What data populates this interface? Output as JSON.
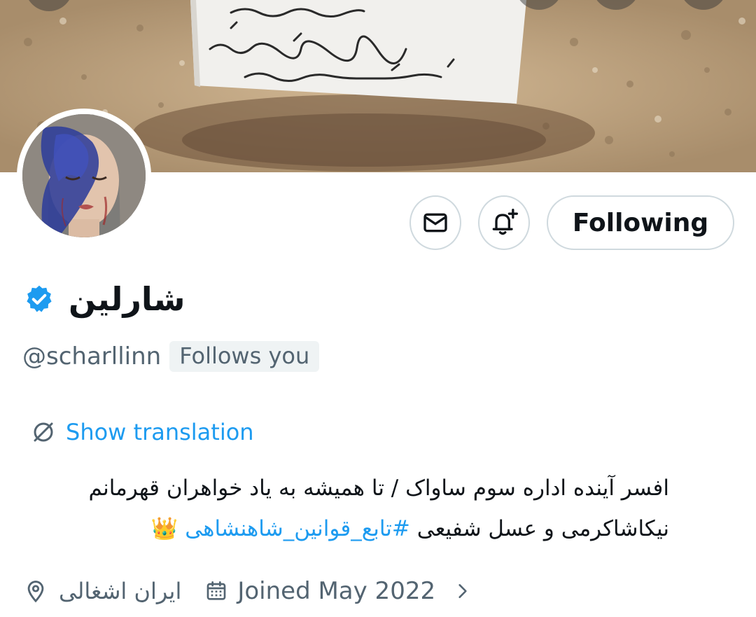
{
  "profile": {
    "display_name": "شارلین",
    "handle": "@scharllinn",
    "follows_you_badge": "Follows you",
    "verified": true,
    "verified_color": "#1d9bf0"
  },
  "actions": {
    "message_icon": "envelope-icon",
    "notify_icon": "bell-plus-icon",
    "follow_label": "Following"
  },
  "translation": {
    "label": "Show translation",
    "icon": "translate-icon"
  },
  "bio": {
    "line1": "افسر آینده اداره سوم ساواک / تا همیشه به یاد خواهران قهرمانم",
    "line2_text": "نیکاشاکرمی و عسل شفیعی ",
    "hashtag": "#تابع_قوانین_شاهنشاهی",
    "emoji": "👑"
  },
  "meta": {
    "location": "ایران اشغالی",
    "joined": "Joined May 2022"
  },
  "colors": {
    "accent": "#1d9bf0",
    "secondary_text": "#536471",
    "border": "#cfd9de"
  }
}
